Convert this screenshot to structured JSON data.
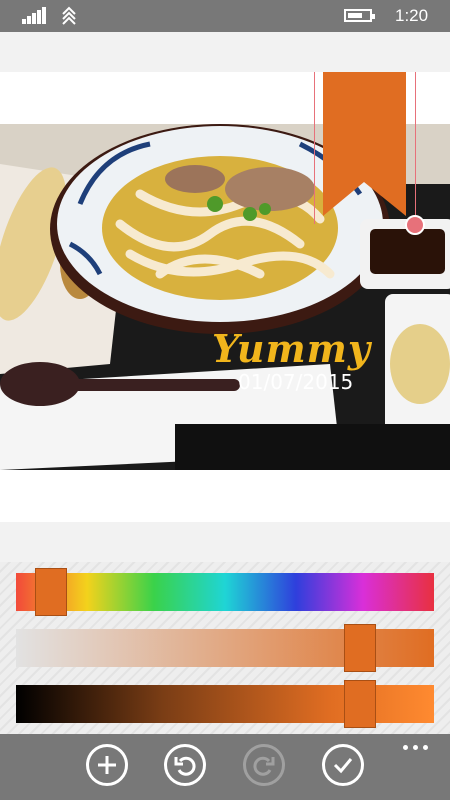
{
  "status_bar": {
    "time": "1:20",
    "battery_fraction": 0.7
  },
  "photo": {
    "caption_title": "Yummy",
    "caption_date": "01/07/2015"
  },
  "accent_color": "#e06d22",
  "ribbon_color": "#e06d22",
  "sliders": {
    "hue": {
      "value": 0.05
    },
    "saturation": {
      "value": 0.85
    },
    "brightness": {
      "value": 0.85
    }
  },
  "app_bar": {
    "buttons": [
      {
        "name": "add",
        "icon": "plus-icon",
        "enabled": true
      },
      {
        "name": "undo",
        "icon": "undo-icon",
        "enabled": true
      },
      {
        "name": "redo",
        "icon": "redo-icon",
        "enabled": false
      },
      {
        "name": "accept",
        "icon": "check-icon",
        "enabled": true
      }
    ],
    "more_icon": "ellipsis-icon"
  }
}
